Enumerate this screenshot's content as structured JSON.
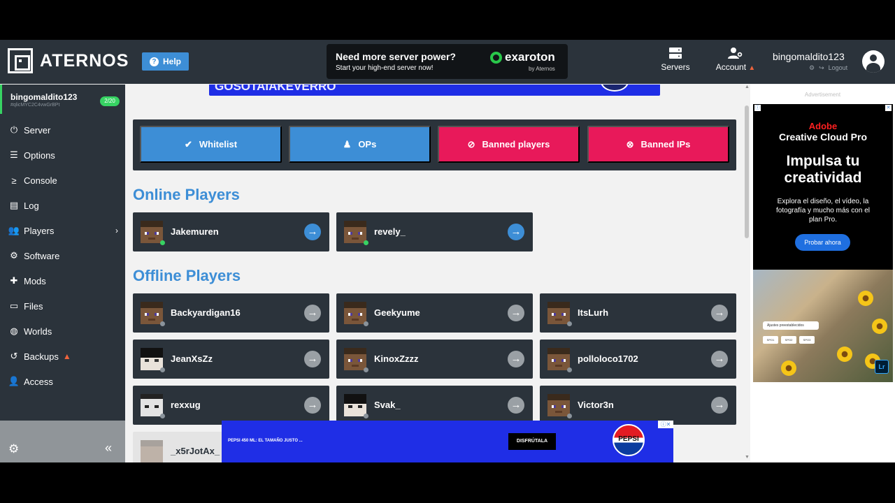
{
  "header": {
    "logo_text": "ATERNOS",
    "help_label": "Help",
    "help_icon": "?",
    "promo_headline": "Need more server power?",
    "promo_sub": "Start your high-end server now!",
    "promo_brand": "exaroton",
    "promo_by": "by Aternos",
    "nav_servers": "Servers",
    "nav_account": "Account",
    "account_warning": "▲",
    "username": "bingomaldito123",
    "logout_label": "Logout"
  },
  "sidebar": {
    "server_name": "bingomaldito123",
    "server_id": "#qlicMYC2C4vwGrBPt",
    "player_count": "2/20",
    "items": [
      {
        "label": "Server",
        "icon": "⏻"
      },
      {
        "label": "Options",
        "icon": "☰"
      },
      {
        "label": "Console",
        "icon": "≥"
      },
      {
        "label": "Log",
        "icon": "▤"
      },
      {
        "label": "Players",
        "icon": "👥",
        "chevron": "›"
      },
      {
        "label": "Software",
        "icon": "⚙"
      },
      {
        "label": "Mods",
        "icon": "✚"
      },
      {
        "label": "Files",
        "icon": "▭"
      },
      {
        "label": "Worlds",
        "icon": "◍"
      },
      {
        "label": "Backups",
        "icon": "↺",
        "warning": "▲"
      },
      {
        "label": "Access",
        "icon": "👤"
      }
    ],
    "settings_icon": "⚙",
    "collapse_icon": "«"
  },
  "main": {
    "top_ad_text": "GOSOTAIAKEVERRO",
    "tabs": [
      {
        "label": "Whitelist",
        "icon": "✔"
      },
      {
        "label": "OPs",
        "icon": "♟"
      },
      {
        "label": "Banned players",
        "icon": "⊘"
      },
      {
        "label": "Banned IPs",
        "icon": "⊗"
      }
    ],
    "online_title": "Online Players",
    "offline_title": "Offline Players",
    "online_players": [
      "Jakemuren",
      "revely_"
    ],
    "offline_players": [
      "Backyardigan16",
      "Geekyume",
      "ItsLurh",
      "JeanXsZz",
      "KinoxZzzz",
      "polloloco1702",
      "rexxug",
      "Svak_",
      "Victor3n",
      "_x5rJotAx_"
    ],
    "arrow_icon": "→"
  },
  "right_ad": {
    "label": "Advertisement",
    "brand1": "Adobe",
    "brand2": "Creative Cloud Pro",
    "headline": "Impulsa tu creatividad",
    "description": "Explora el diseño, el vídeo, la fotografía y mucho más con el plan Pro.",
    "cta": "Probar ahora",
    "chip": "Ajustes preestablecidos",
    "chips": [
      "SPO1",
      "SPO2",
      "SPO3"
    ],
    "app_badge": "Lr"
  },
  "bottom_ad": {
    "text": "PEPSI 450 ML: EL TAMAÑO JUSTO ...",
    "button": "DISFRÚTALA",
    "brand": "PEPSI",
    "close": "ⓘ✕"
  },
  "colors": {
    "dark": "#2b333b",
    "blue": "#3d8ed6",
    "red": "#e8195a",
    "online": "#37d363"
  }
}
